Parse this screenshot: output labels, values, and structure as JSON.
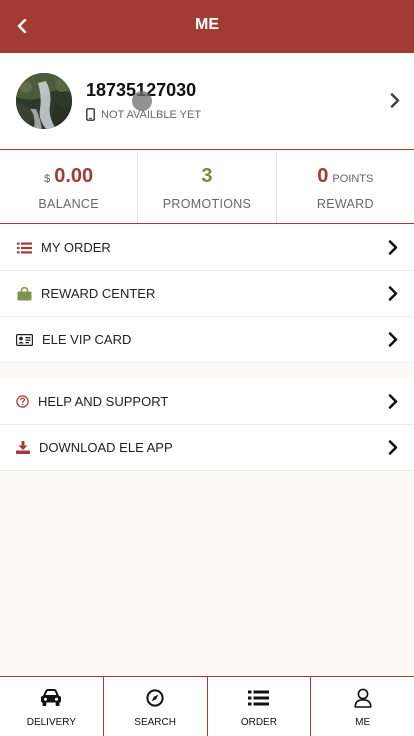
{
  "header": {
    "title": "ME",
    "back_icon": "chevron-left-icon"
  },
  "profile": {
    "phone": "18735127030",
    "mobile_status": "NOT AVAILBLE YET",
    "icons": {
      "avatar": "waterfall-photo",
      "device": "mobile-phone-icon",
      "arrow": "chevron-right-icon"
    }
  },
  "stats": {
    "balance": {
      "currency": "$",
      "value": "0.00",
      "label": "BALANCE"
    },
    "promotions": {
      "value": "3",
      "label": "PROMOTIONS"
    },
    "reward": {
      "value": "0",
      "unit": "POINTS",
      "label": "REWARD"
    }
  },
  "menu": {
    "group1": [
      {
        "label": "MY ORDER",
        "icon": "list-icon"
      },
      {
        "label": "REWARD CENTER",
        "icon": "shopping-bag-icon"
      },
      {
        "label": "ELE VIP CARD",
        "icon": "id-card-icon"
      }
    ],
    "group2": [
      {
        "label": "HELP AND SUPPORT",
        "icon": "question-circle-icon"
      },
      {
        "label": "DOWNLOAD ELE APP",
        "icon": "download-icon"
      }
    ]
  },
  "tabbar": {
    "tabs": [
      {
        "label": "DELIVERY",
        "icon": "car-icon"
      },
      {
        "label": "SEARCH",
        "icon": "compass-icon"
      },
      {
        "label": "ORDER",
        "icon": "list-icon"
      },
      {
        "label": "ME",
        "icon": "user-icon"
      }
    ]
  },
  "colors": {
    "brand": "#a23b33",
    "promo_green": "#6f8f3f",
    "background": "#fbfaf8"
  }
}
